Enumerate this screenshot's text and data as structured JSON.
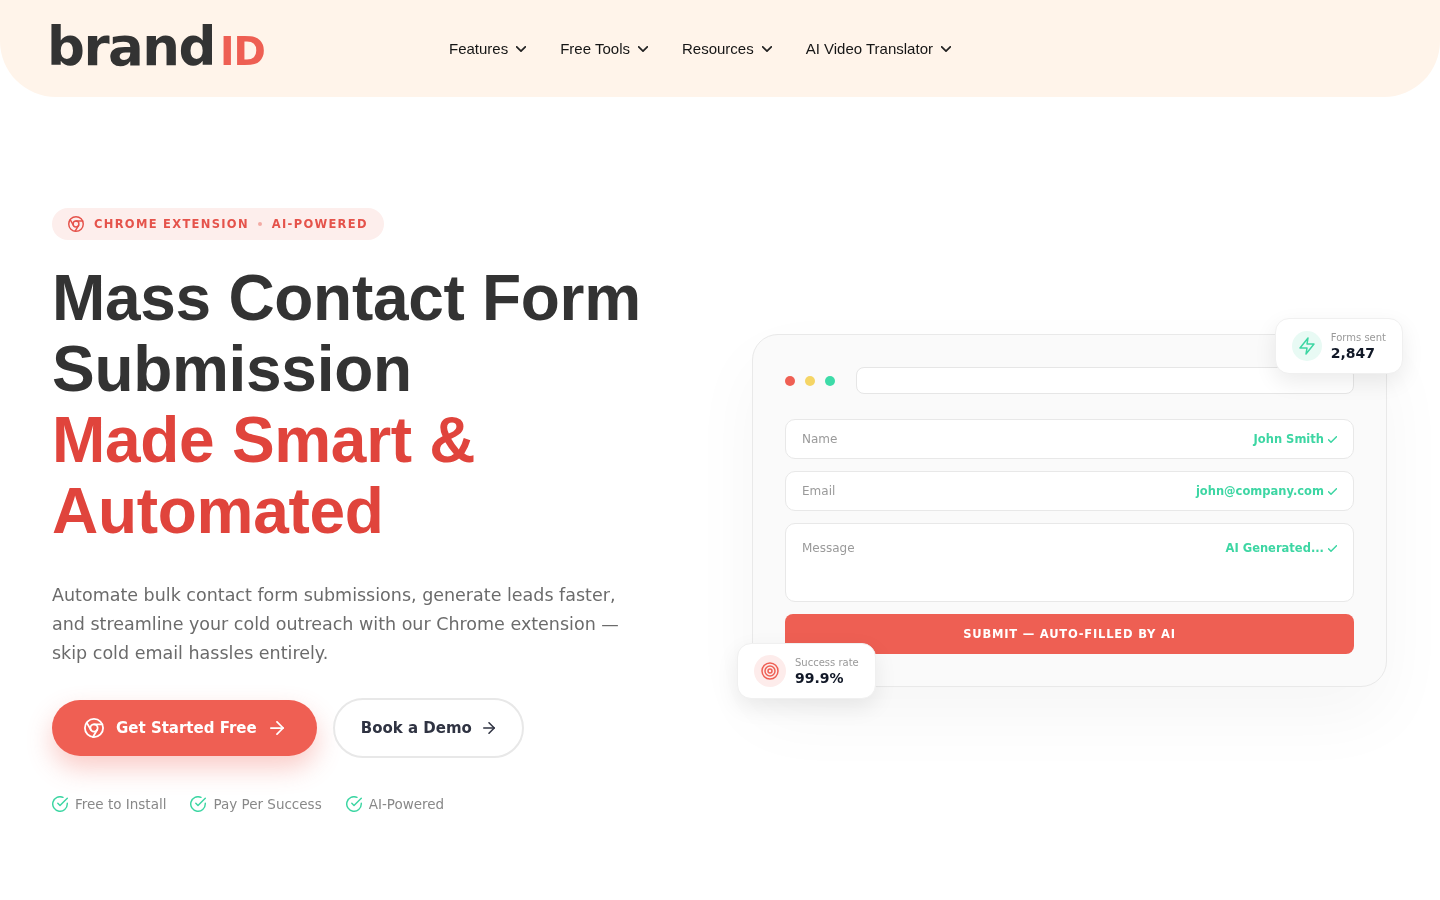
{
  "header": {
    "logo": {
      "wordmark": "brand",
      "accent": "ID"
    },
    "nav": [
      {
        "label": "Features"
      },
      {
        "label": "Free Tools"
      },
      {
        "label": "Resources"
      },
      {
        "label": "AI Video Translator"
      }
    ]
  },
  "hero": {
    "badge": [
      "CHROME EXTENSION",
      "AI-POWERED"
    ],
    "title": "Mass Contact Form Submission",
    "title_highlight": "Made Smart & Automated",
    "description": "Automate bulk contact form submissions, generate leads faster, and streamline your cold outreach with our Chrome extension — skip cold email hassles entirely.",
    "buttons": [
      {
        "label": "Get Started Free",
        "kind": "primary"
      },
      {
        "label": "Book a Demo",
        "kind": "secondary"
      }
    ],
    "highlights": [
      "Free to Install",
      "Pay Per Success",
      "AI-Powered"
    ]
  },
  "mockup": {
    "fields": [
      {
        "label": "Name",
        "value": "John Smith",
        "kind": "line"
      },
      {
        "label": "Email",
        "value": "john@company.com",
        "kind": "line"
      },
      {
        "label": "Message",
        "value": "AI Generated...",
        "kind": "area"
      }
    ],
    "submit": "SUBMIT — AUTO-FILLED BY AI",
    "stats": [
      {
        "label": "Forms sent",
        "value": "2,847",
        "kind": "bolt"
      },
      {
        "label": "Success rate",
        "value": "99.9%",
        "kind": "target"
      }
    ]
  }
}
